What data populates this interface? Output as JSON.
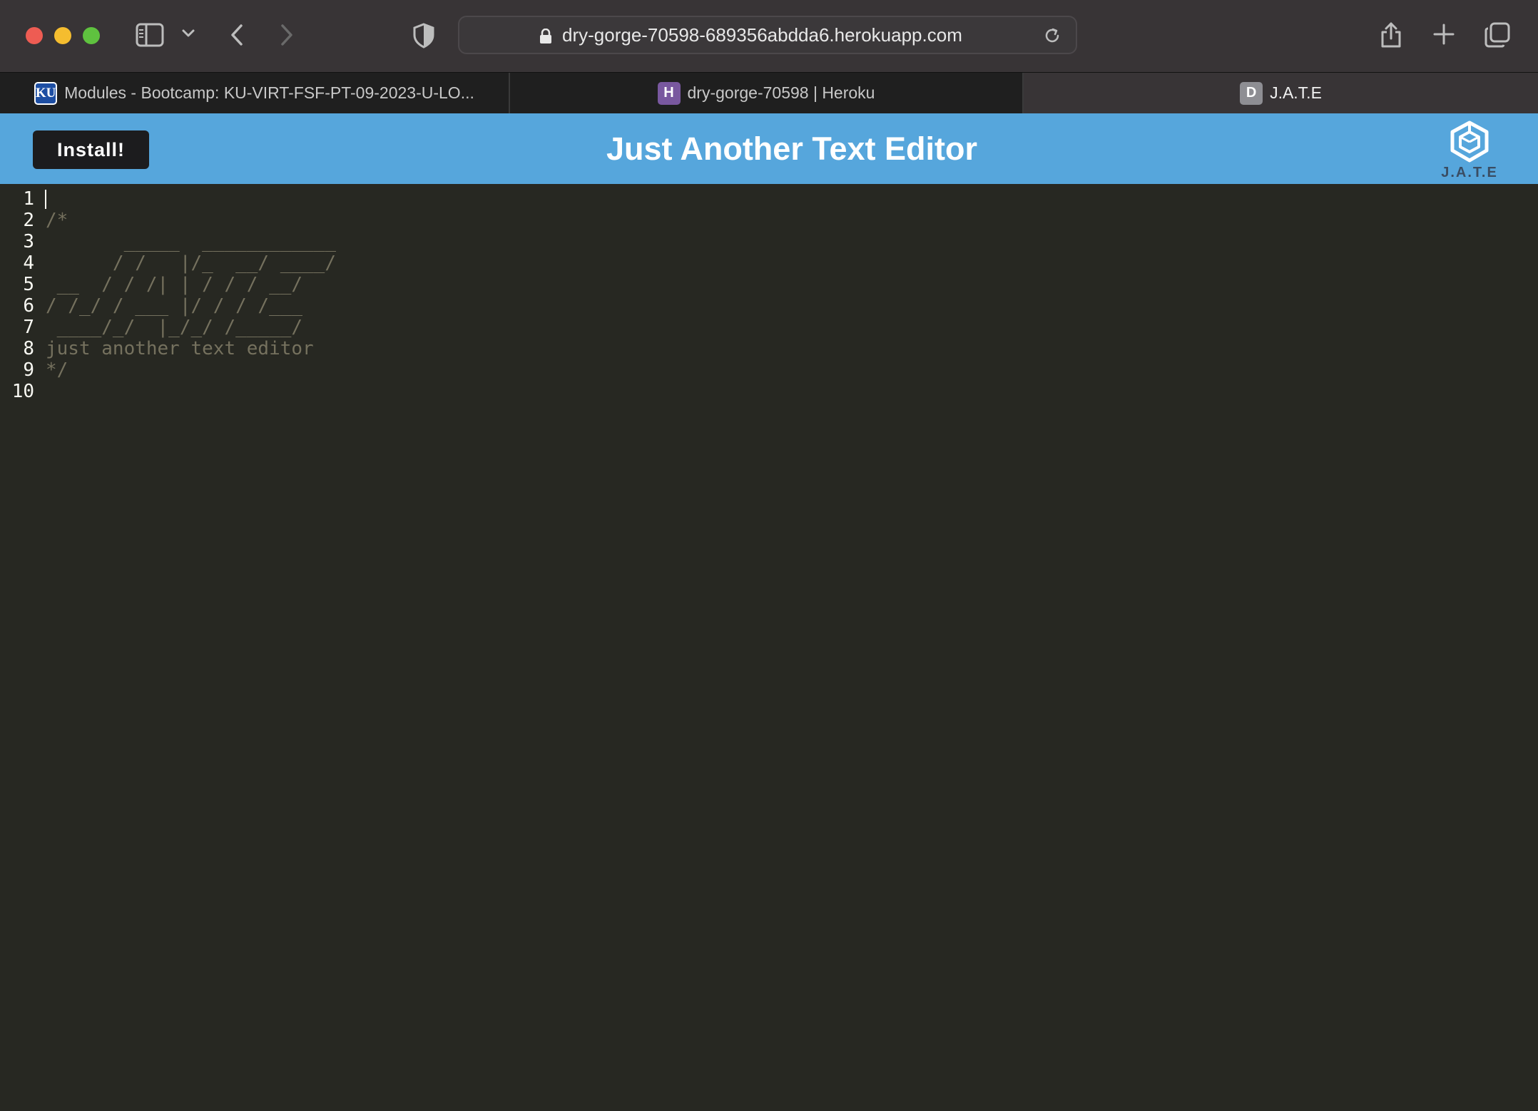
{
  "browser": {
    "url": "dry-gorge-70598-689356abdda6.herokuapp.com",
    "tabs": [
      {
        "title": "Modules - Bootcamp: KU-VIRT-FSF-PT-09-2023-U-LO...",
        "favicon": "KU",
        "active": false
      },
      {
        "title": "dry-gorge-70598 | Heroku",
        "favicon": "H",
        "active": false
      },
      {
        "title": "J.A.T.E",
        "favicon": "D",
        "active": true
      }
    ],
    "icons": [
      "sidebar-icon",
      "chevron-down-icon",
      "back-icon",
      "forward-icon",
      "privacy-shield-icon",
      "lock-icon",
      "reload-icon",
      "share-icon",
      "new-tab-icon",
      "tab-overview-icon"
    ]
  },
  "app": {
    "title": "Just Another Text Editor",
    "install_label": "Install!",
    "logo_text": "J.A.T.E",
    "header_color": "#56a6dc"
  },
  "editor": {
    "theme_background": "#272822",
    "lines": [
      {
        "num": "1",
        "text": ""
      },
      {
        "num": "2",
        "text": "/*"
      },
      {
        "num": "3",
        "text": "       _____  ____________  "
      },
      {
        "num": "4",
        "text": "      / /   |/_  __/ ____/"
      },
      {
        "num": "5",
        "text": " __  / / /| | / / / __/"
      },
      {
        "num": "6",
        "text": "/ /_/ / ___ |/ / / /___"
      },
      {
        "num": "7",
        "text": " ____/_/  |_/_/ /_____/"
      },
      {
        "num": "8",
        "text": "just another text editor"
      },
      {
        "num": "9",
        "text": "*/"
      },
      {
        "num": "10",
        "text": ""
      }
    ]
  }
}
